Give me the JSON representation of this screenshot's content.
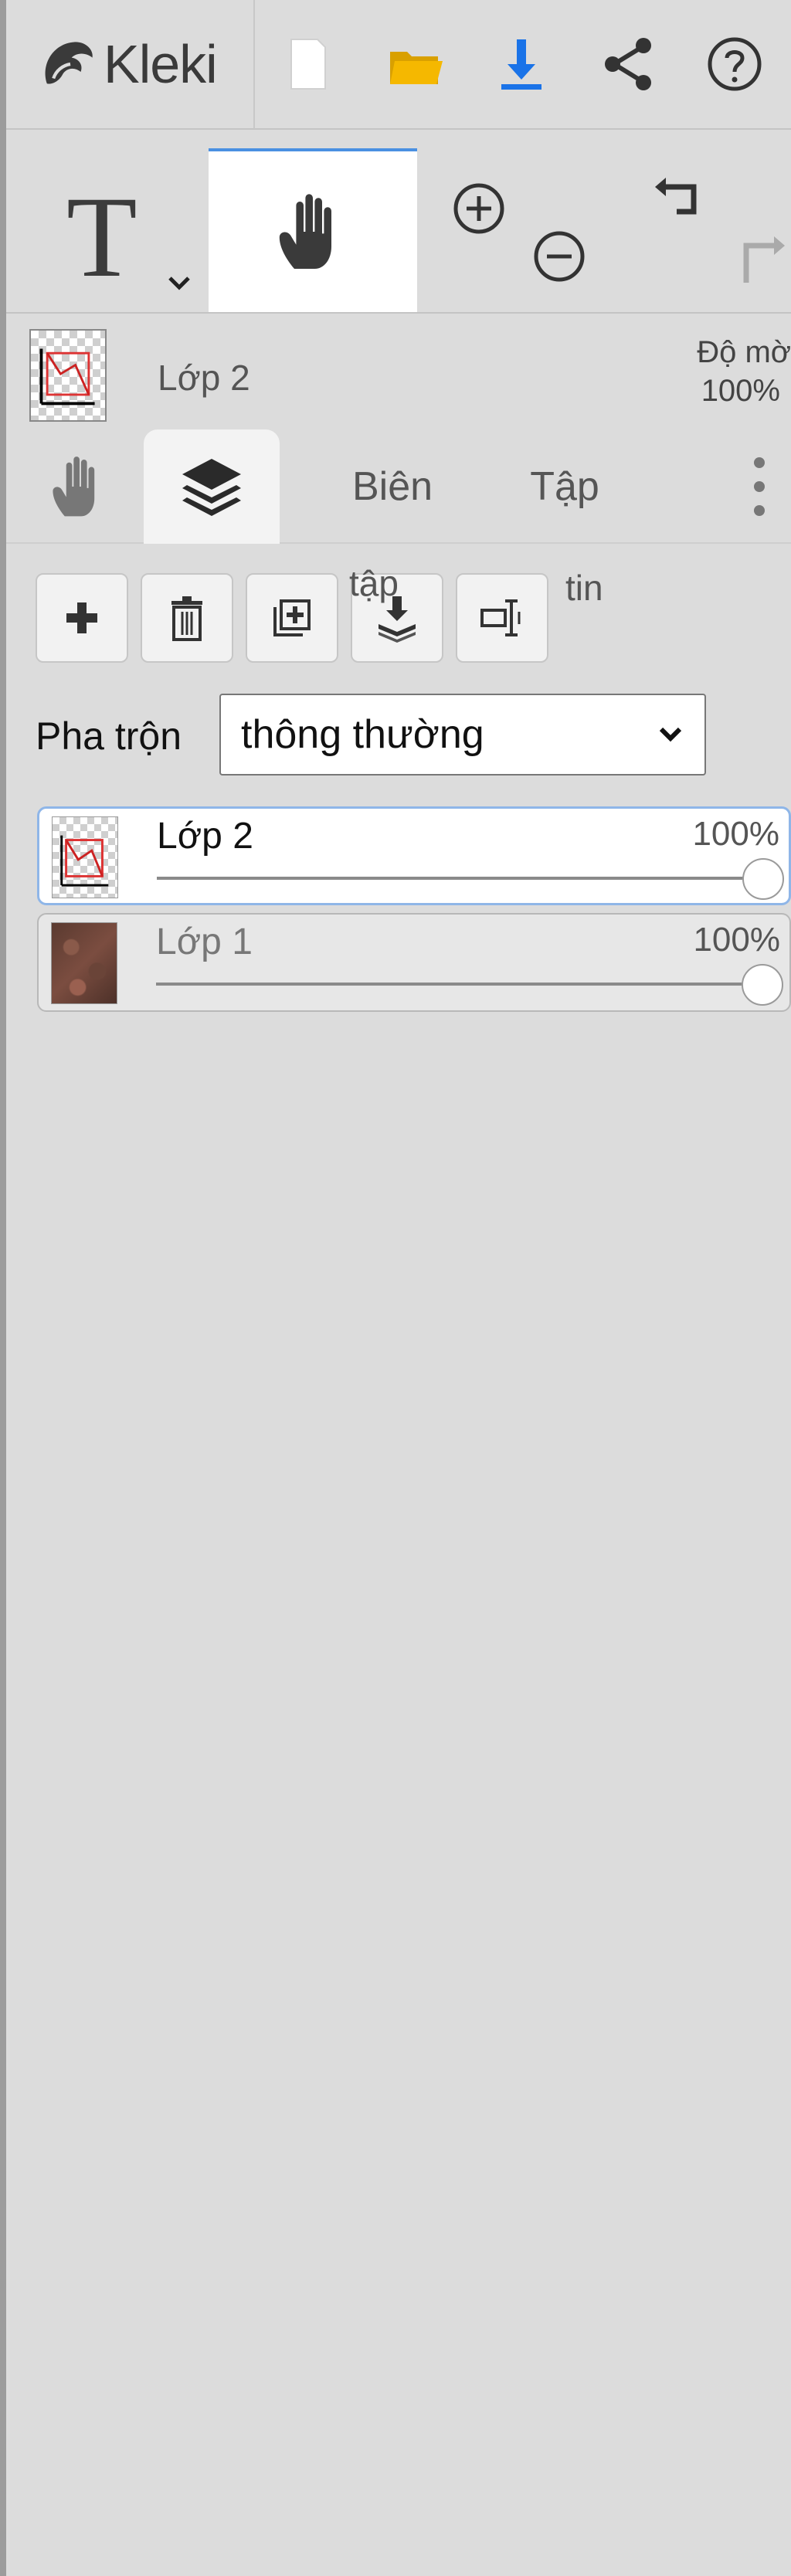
{
  "app": {
    "name": "Kleki"
  },
  "topbar": {
    "buttons": [
      {
        "name": "new-file",
        "icon": "blank-page-icon"
      },
      {
        "name": "open-file",
        "icon": "folder-icon"
      },
      {
        "name": "save-download",
        "icon": "download-icon"
      },
      {
        "name": "share",
        "icon": "share-icon"
      },
      {
        "name": "help",
        "icon": "question-icon"
      }
    ]
  },
  "tools": {
    "text_tool_glyph": "T",
    "active_tool": "hand-icon"
  },
  "layer_info": {
    "name": "Lớp 2",
    "opacity_label": "Độ mờ",
    "opacity_value": "100%"
  },
  "tabs": {
    "items": [
      {
        "label": "",
        "icon": "hand-icon"
      },
      {
        "label": "",
        "icon": "layers-icon",
        "active": true
      },
      {
        "label": "Biên"
      },
      {
        "label": "Tập"
      },
      {
        "label": "",
        "icon": "more-vertical-icon"
      }
    ],
    "bien": "Biên",
    "tap": "Tập"
  },
  "layer_actions": {
    "stray_text_1": "tập",
    "stray_text_2": "tin"
  },
  "blend": {
    "label": "Pha trộn",
    "value": "thông thường"
  },
  "layers": [
    {
      "name": "Lớp 2",
      "opacity": "100%",
      "active": true
    },
    {
      "name": "Lớp 1",
      "opacity": "100%",
      "active": false
    }
  ],
  "colors": {
    "accent": "#4a90e2",
    "folder": "#f5b800",
    "download": "#1a73e8",
    "panel_bg": "#dcdcdc"
  }
}
